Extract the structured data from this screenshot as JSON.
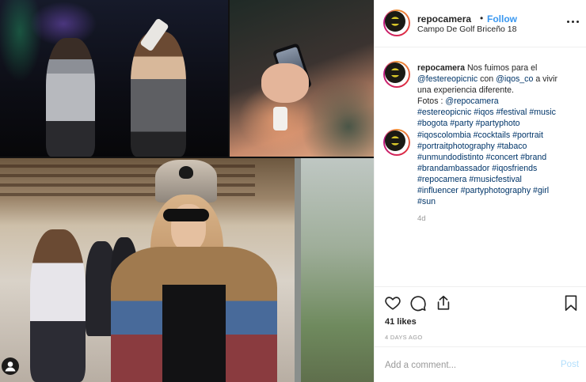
{
  "header": {
    "username": "repocamera",
    "separator": "•",
    "follow_label": "Follow",
    "location": "Campo De Golf Briceño 18",
    "more_icon": "more-options-icon"
  },
  "caption": {
    "lines": [
      [
        {
          "t": "repocamera",
          "k": "user"
        },
        {
          "t": " Nos fuimos para el",
          "k": "text"
        }
      ],
      [
        {
          "t": "@festereopicnic",
          "k": "link"
        },
        {
          "t": " con ",
          "k": "text"
        },
        {
          "t": "@iqos_co",
          "k": "link"
        },
        {
          "t": " a vivir",
          "k": "text"
        }
      ],
      [
        {
          "t": "una experiencia diferente.",
          "k": "text"
        }
      ],
      [
        {
          "t": "Fotos : ",
          "k": "text"
        },
        {
          "t": "@repocamera",
          "k": "link"
        }
      ],
      [
        {
          "t": "#estereopicnic #iqos #festival #music",
          "k": "link"
        }
      ],
      [
        {
          "t": "#bogota #party #partyphoto",
          "k": "link"
        }
      ],
      [
        {
          "t": "#iqoscolombia #cocktails #portrait",
          "k": "link"
        }
      ],
      [
        {
          "t": "#portraitphotography #tabaco",
          "k": "link"
        }
      ],
      [
        {
          "t": "#unmundodistinto #concert #brand",
          "k": "link"
        }
      ],
      [
        {
          "t": "#brandambassador #iqosfriends",
          "k": "link"
        }
      ],
      [
        {
          "t": "#repocamera #musicfestival",
          "k": "link"
        }
      ],
      [
        {
          "t": "#influencer #partyphotography #girl",
          "k": "link"
        }
      ],
      [
        {
          "t": "#sun",
          "k": "link"
        }
      ]
    ],
    "age": "4d"
  },
  "actions": {
    "likes": "41 likes",
    "timestamp": "4 DAYS AGO"
  },
  "comment": {
    "placeholder": "Add a comment...",
    "post_label": "Post"
  },
  "colors": {
    "link": "#003569",
    "follow": "#3897f0",
    "post_disabled": "#b2dffc",
    "muted": "#999999"
  }
}
